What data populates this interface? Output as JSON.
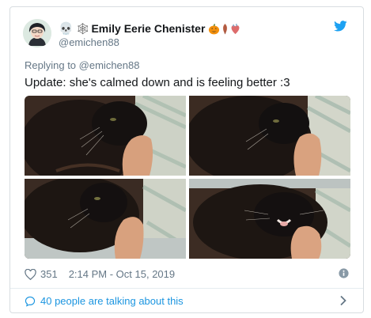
{
  "tweet": {
    "display_name": "Emily Eerie Chenister",
    "name_emojis_leading": [
      "skull",
      "spider-web"
    ],
    "name_emojis_trailing": [
      "jack-o-lantern",
      "leaf",
      "anatomical-heart"
    ],
    "handle": "@emichen88",
    "replying_prefix": "Replying to",
    "replying_to": "@emichen88",
    "text": "Update: she's calmed down and is feeling better :3",
    "like_count": "351",
    "timestamp": "2:14 PM - Oct 15, 2019",
    "conversation_label": "40 people are talking about this",
    "photo_count": 4
  },
  "colors": {
    "brand": "#1da1f2",
    "link": "#1b95e0",
    "secondary_text": "#657786",
    "primary_text": "#14171a",
    "border": "#d8dde1"
  },
  "icons": [
    "skull-icon",
    "spider-web-icon",
    "pumpkin-icon",
    "leaf-icon",
    "heart-organ-icon",
    "twitter-bird-icon",
    "like-heart-icon",
    "info-icon",
    "conversation-bubble-icon",
    "chevron-right-icon"
  ]
}
